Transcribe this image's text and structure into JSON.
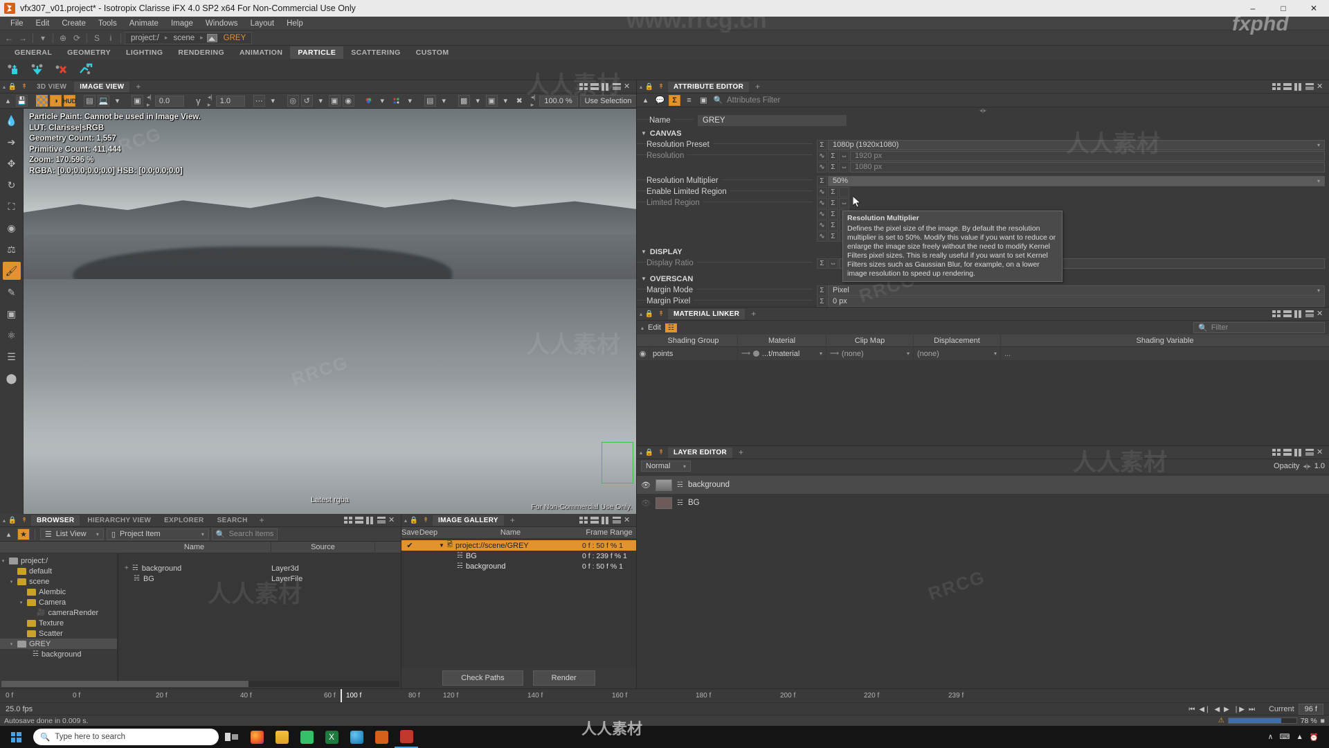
{
  "window": {
    "title": "vfx307_v01.project* - Isotropix Clarisse iFX 4.0 SP2 x64  For Non-Commercial Use Only",
    "minimize": "–",
    "maximize": "□",
    "close": "✕"
  },
  "menu": {
    "items": [
      "File",
      "Edit",
      "Create",
      "Tools",
      "Animate",
      "Image",
      "Windows",
      "Layout",
      "Help"
    ]
  },
  "breadcrumb": {
    "back": "←",
    "forward": "→",
    "dropdown": "▾",
    "target": "⊕",
    "reload": "⟳",
    "stop": "S",
    "info": "i",
    "items": [
      "project:/",
      "scene",
      "GREY"
    ],
    "sep": "▸"
  },
  "shelf": {
    "tabs": [
      "GENERAL",
      "GEOMETRY",
      "LIGHTING",
      "RENDERING",
      "ANIMATION",
      "PARTICLE",
      "SCATTERING",
      "CUSTOM"
    ],
    "selected": "PARTICLE",
    "icons": [
      "particle-add-icon",
      "particle-drop-icon",
      "particle-delete-icon",
      "particle-move-icon"
    ]
  },
  "viewer": {
    "tabs": [
      "3D VIEW",
      "IMAGE VIEW"
    ],
    "selected_tab": "IMAGE VIEW",
    "add_tab": "+",
    "toolbar": {
      "checker_label": "",
      "hud_label": "HUD",
      "exposure_value": "0.0",
      "gamma_value": "1.0",
      "zoom_value": "100.0 %",
      "selection_mode": "Use Selection",
      "progress": "78 %",
      "play": "▶",
      "pause": "❘❘",
      "refresh": "↻"
    },
    "hud_lines": [
      "Particle Paint: Cannot be used in Image View.",
      "LUT: Clarisse|sRGB",
      "Geometry Count: 1,557",
      "Primitive Count: 411,444",
      "Zoom: 170.596 %",
      "RGBA: [0.0;0.0;0.0;0.0] HSB: [0.0;0.0;0.0]"
    ],
    "latest_label": "Latest rgba",
    "noncommercial": "For Non-Commercial Use Only."
  },
  "tool_rail": {
    "items": [
      "eyedropper-icon",
      "arrow-select-icon",
      "move-icon",
      "rotate-icon",
      "scale-icon",
      "transform-icon",
      "stamp-icon",
      "paint-brush-icon",
      "pen-icon",
      "crop-icon",
      "magnet-icon",
      "measure-icon",
      "sphere-icon"
    ],
    "selected_index": 7
  },
  "browser": {
    "tabs": [
      "BROWSER",
      "HIERARCHY VIEW",
      "EXPLORER",
      "SEARCH"
    ],
    "selected_tab": "BROWSER",
    "add_tab": "+",
    "view_mode": "List View",
    "filter_mode": "Project Item",
    "search_placeholder": "Search Items",
    "columns": [
      "Name",
      "Source"
    ],
    "tree": [
      {
        "label": "project:/",
        "indent": 0,
        "icon": "folder-gray-icon",
        "twisty": "▾",
        "selected": false
      },
      {
        "label": "default",
        "indent": 1,
        "icon": "folder-gold-icon",
        "twisty": "",
        "selected": false
      },
      {
        "label": "scene",
        "indent": 1,
        "icon": "folder-gold-icon",
        "twisty": "▾",
        "selected": false
      },
      {
        "label": "Alembic",
        "indent": 2,
        "icon": "folder-gold-icon",
        "twisty": "",
        "selected": false
      },
      {
        "label": "Camera",
        "indent": 2,
        "icon": "folder-gold-icon",
        "twisty": "▾",
        "selected": false
      },
      {
        "label": "cameraRender",
        "indent": 3,
        "icon": "camera-icon",
        "twisty": "",
        "selected": false
      },
      {
        "label": "Texture",
        "indent": 2,
        "icon": "folder-gold-icon",
        "twisty": "",
        "selected": false
      },
      {
        "label": "Scatter",
        "indent": 2,
        "icon": "folder-gold-icon",
        "twisty": "",
        "selected": false
      },
      {
        "label": "GREY",
        "indent": 1,
        "icon": "folder-gray-icon",
        "twisty": "▾",
        "selected": true
      },
      {
        "label": "background",
        "indent": 2,
        "icon": "layer-icon",
        "twisty": "",
        "selected": false
      }
    ],
    "rows": [
      {
        "name": "background",
        "source": "Layer3d",
        "expand": "+"
      },
      {
        "name": "BG",
        "source": "LayerFile",
        "expand": ""
      }
    ]
  },
  "gallery": {
    "tabs": [
      "IMAGE GALLERY"
    ],
    "add_tab": "+",
    "columns": [
      "Save",
      "Deep",
      "Name",
      "Frame Range"
    ],
    "rows": [
      {
        "save": "✔",
        "deep": "",
        "name": "project://scene/GREY",
        "range": "0 f : 50 f % 1",
        "selected": true,
        "indent": 0,
        "icon": "image-icon"
      },
      {
        "save": "",
        "deep": "",
        "name": "BG",
        "range": "0 f : 239 f % 1",
        "selected": false,
        "indent": 1,
        "icon": "layer-icon"
      },
      {
        "save": "",
        "deep": "",
        "name": "background",
        "range": "0 f : 50 f % 1",
        "selected": false,
        "indent": 1,
        "icon": "layer-icon"
      }
    ],
    "buttons": [
      "Check Paths",
      "Render"
    ]
  },
  "attribute_editor": {
    "tab": "ATTRIBUTE EDITOR",
    "add_tab": "+",
    "filter_placeholder": "Attributes Filter",
    "filter_icons": [
      "comment-icon",
      "sigma-icon",
      "list-icon",
      "anim-icon",
      "search-icon"
    ],
    "name_label": "Name",
    "name_value": "GREY",
    "sections": [
      {
        "title": "CANVAS",
        "rows": [
          {
            "label": "Resolution Preset",
            "value": "1080p (1920x1080)",
            "dim": false,
            "dropdown": true,
            "sigma": true,
            "curve": false
          },
          {
            "label": "Resolution",
            "value": "1920 px",
            "dim": true,
            "dropdown": false,
            "sigma": true,
            "curve": true
          },
          {
            "label": "",
            "value": "1080 px",
            "dim": true,
            "dropdown": false,
            "sigma": true,
            "curve": true
          },
          {
            "label": "Resolution Multiplier",
            "value": "50%",
            "dim": false,
            "dropdown": true,
            "sigma": true,
            "curve": false
          },
          {
            "label": "Enable Limited Region",
            "value": "",
            "dim": false,
            "dropdown": false,
            "sigma": true,
            "curve": true
          },
          {
            "label": "Limited Region",
            "value": "",
            "dim": true,
            "dropdown": false,
            "sigma": true,
            "curve": true
          }
        ]
      },
      {
        "title": "DISPLAY",
        "rows": [
          {
            "label": "Display Ratio",
            "value": "1.0",
            "dim": true,
            "dropdown": false,
            "sigma": true,
            "curve": false
          }
        ]
      },
      {
        "title": "OVERSCAN",
        "rows": [
          {
            "label": "Margin Mode",
            "value": "Pixel",
            "dim": false,
            "dropdown": true,
            "sigma": true,
            "curve": false
          },
          {
            "label": "Margin Pixel",
            "value": "0 px",
            "dim": false,
            "dropdown": false,
            "sigma": true,
            "curve": false
          }
        ]
      }
    ],
    "tooltip": {
      "title": "Resolution Multiplier",
      "body": "Defines the pixel size of the image. By default the resolution multiplier is set to 50%. Modify this value if you want to reduce or enlarge the image size freely without the need to modify Kernel Filters pixel sizes. This is really useful if you want to set Kernel Filters sizes such as Gaussian Blur, for example, on a lower image resolution to speed up rendering."
    }
  },
  "material_linker": {
    "tab": "MATERIAL LINKER",
    "add_tab": "+",
    "edit_label": "Edit",
    "filter_placeholder": "Filter",
    "columns": [
      "Shading Group",
      "Material",
      "Clip Map",
      "Displacement",
      "Shading Variable"
    ],
    "rows": [
      {
        "eye": "◉",
        "group": "points",
        "material": "...t/material",
        "clip_map": "(none)",
        "displacement": "(none)",
        "shading_variable": ""
      }
    ],
    "more": "..."
  },
  "layer_editor": {
    "tab": "LAYER EDITOR",
    "add_tab": "+",
    "blend_mode": "Normal",
    "opacity_label": "Opacity",
    "opacity_value": "1.0",
    "layers": [
      {
        "name": "background",
        "visible": true,
        "selected": true,
        "thumb": "grey"
      },
      {
        "name": "BG",
        "visible": false,
        "selected": false,
        "thumb": "pink"
      }
    ]
  },
  "timeline": {
    "ticks": [
      "0 f",
      "0 f",
      "20 f",
      "40 f",
      "60 f",
      "80 f",
      "100 f",
      "120 f",
      "140 f",
      "160 f",
      "180 f",
      "200 f",
      "220 f",
      "239 f"
    ],
    "playhead_label": "100 f",
    "fps": "25.0 fps",
    "current_label": "Current",
    "current_value": "96 f",
    "transport": [
      "⏮",
      "◀❘",
      "◀",
      "▶",
      "❘▶",
      "⏭"
    ]
  },
  "status_bar": {
    "message": "Autosave done in 0.009 s.",
    "progress": "78 %",
    "warn_icon": "warning-icon"
  },
  "taskbar": {
    "search_placeholder": "Type here to search",
    "apps": [
      "task-view-icon",
      "firefox-icon",
      "file-explorer-icon",
      "store-icon",
      "excel-icon",
      "chrome-icon",
      "clarisse-icon",
      "app-red-icon"
    ],
    "tray": [
      "∧",
      "⌨",
      "▲",
      "⏰"
    ],
    "clock": ""
  },
  "watermarks": {
    "site": "www.rrcg.cn",
    "brand": "fxphd",
    "cn": "人人素材",
    "rr": "RRCG"
  },
  "colors": {
    "accent": "#e2922f",
    "selection": "#e2922f",
    "progress": "#7d96b4"
  }
}
